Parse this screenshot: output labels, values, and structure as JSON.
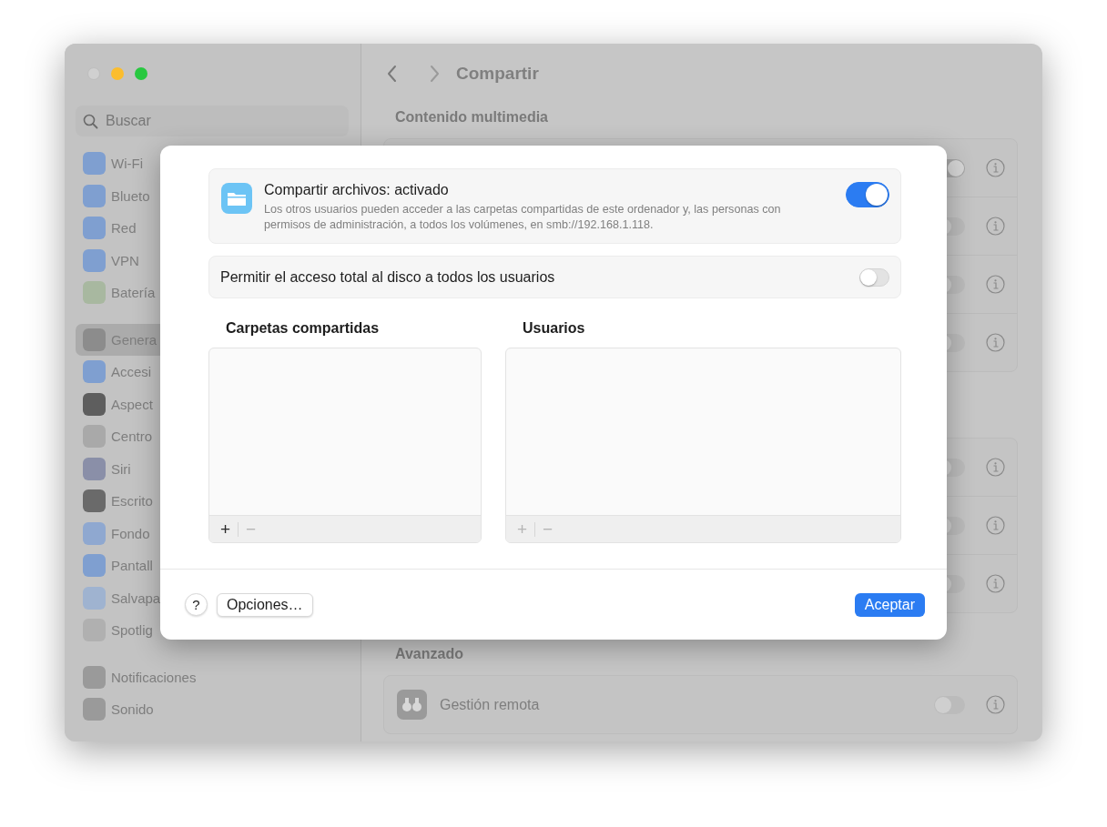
{
  "sidebar": {
    "search": {
      "placeholder": "Buscar"
    },
    "groups": [
      [
        {
          "label": "Wi-Fi",
          "selected": false,
          "color": "#7f9fd0"
        },
        {
          "label": "Blueto",
          "selected": false,
          "color": "#7f9fd0"
        },
        {
          "label": "Red",
          "selected": false,
          "color": "#7f9fd0"
        },
        {
          "label": "VPN",
          "selected": false,
          "color": "#7f9fd0"
        },
        {
          "label": "Batería",
          "selected": false,
          "color": "#a8b8a0"
        }
      ],
      [
        {
          "label": "Genera",
          "selected": true,
          "color": "#8c8c8c"
        },
        {
          "label": "Accesi",
          "selected": false,
          "color": "#7f9fd0"
        },
        {
          "label": "Aspect",
          "selected": false,
          "color": "#5e5e5e"
        },
        {
          "label": "Centro",
          "selected": false,
          "color": "#a9a9a9"
        },
        {
          "label": "Siri",
          "selected": false,
          "color": "#8a8fa8"
        },
        {
          "label": "Escrito",
          "selected": false,
          "color": "#6a6a6a"
        },
        {
          "label": "Fondo",
          "selected": false,
          "color": "#8fa8d0"
        },
        {
          "label": "Pantall",
          "selected": false,
          "color": "#7f9fd0"
        },
        {
          "label": "Salvapa",
          "selected": false,
          "color": "#9fb3d0"
        },
        {
          "label": "Spotlig",
          "selected": false,
          "color": "#b0b0b0"
        }
      ],
      [
        {
          "label": "Notificaciones",
          "selected": false,
          "color": "#9a9a9a"
        },
        {
          "label": "Sonido",
          "selected": false,
          "color": "#9a9a9a"
        }
      ]
    ]
  },
  "main": {
    "title": "Compartir",
    "sections": [
      {
        "heading": "Contenido multimedia",
        "rows": [
          {
            "on": true
          },
          {
            "on": false
          },
          {
            "on": false
          },
          {
            "on": false
          }
        ]
      },
      {
        "rows": [
          {
            "on": false
          },
          {
            "on": false
          },
          {
            "on": false
          }
        ]
      },
      {
        "heading": "Avanzado",
        "rows": [
          {
            "label": "Gestión remota",
            "on": false
          }
        ]
      }
    ]
  },
  "dialog": {
    "service": {
      "title": "Compartir archivos: activado",
      "description": "Los otros usuarios pueden acceder a las carpetas compartidas de este ordenador y, las personas con permisos de administración, a todos los volúmenes, en smb://192.168.1.118.",
      "on": true
    },
    "full_disk": {
      "label": "Permitir el acceso total al disco a todos los usuarios",
      "on": false
    },
    "lists": [
      {
        "heading": "Carpetas compartidas",
        "add": {
          "label": "+",
          "disabled": false
        },
        "remove": {
          "label": "−",
          "disabled": true
        }
      },
      {
        "heading": "Usuarios",
        "add": {
          "label": "+",
          "disabled": true
        },
        "remove": {
          "label": "−",
          "disabled": true
        }
      }
    ],
    "help": "?",
    "options": "Opciones…",
    "accept": "Aceptar"
  }
}
